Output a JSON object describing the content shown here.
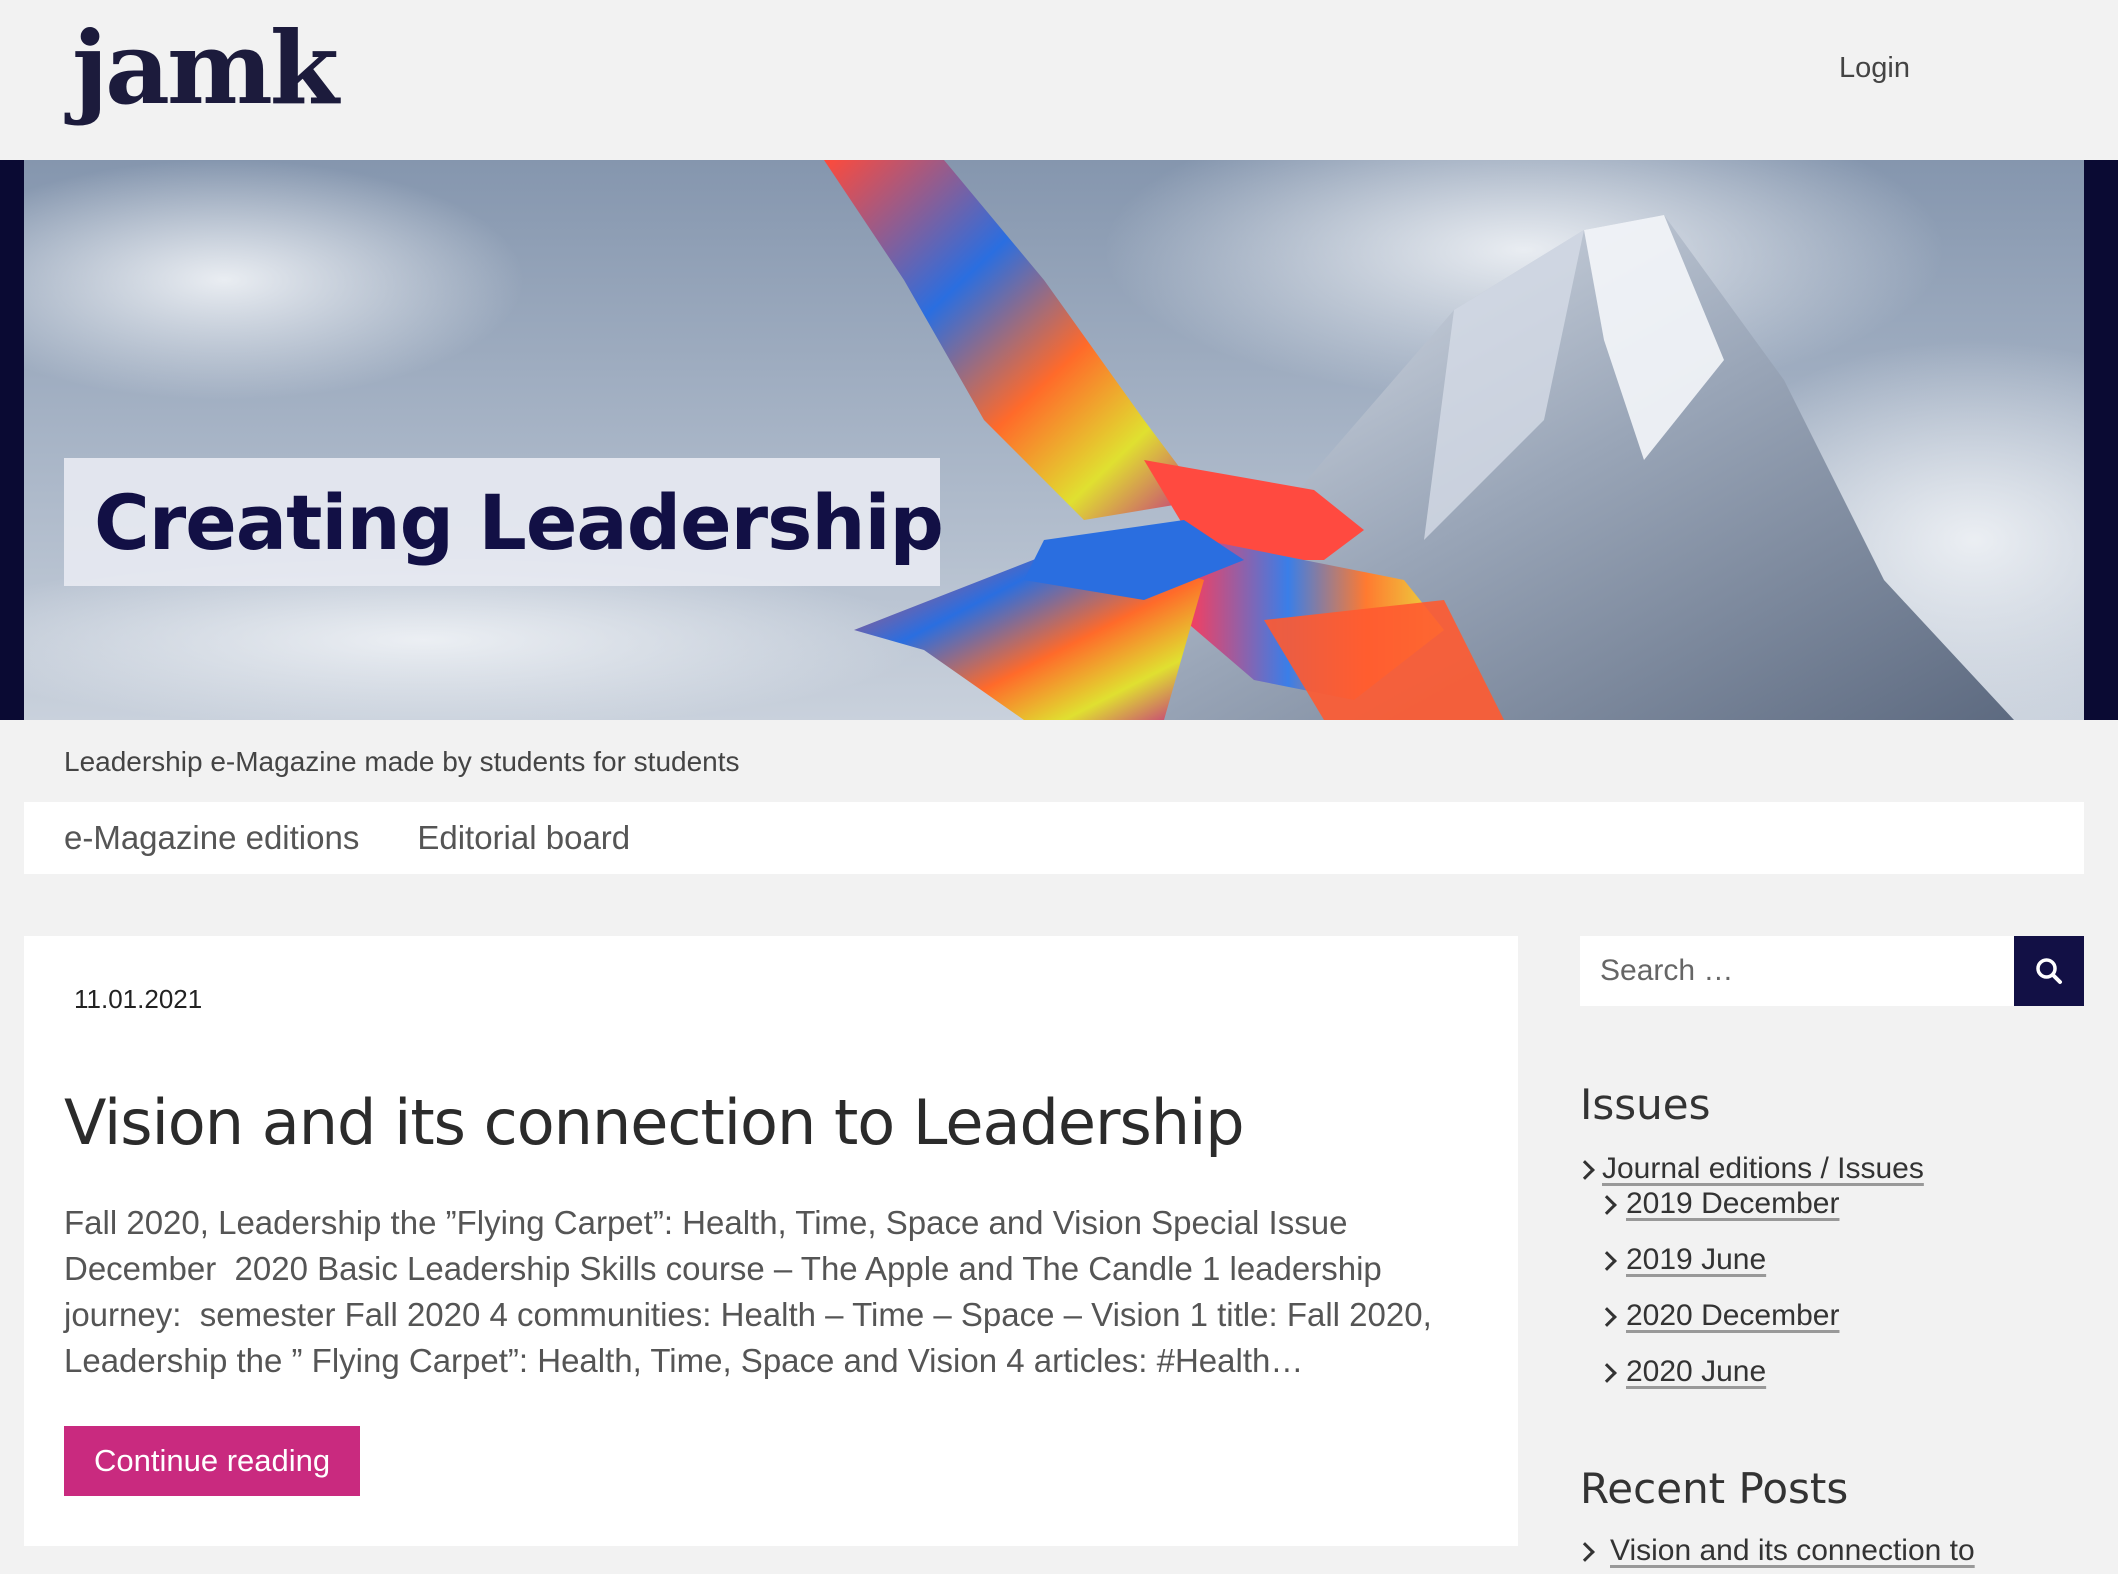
{
  "header": {
    "logo_text": "jamk",
    "login_label": "Login"
  },
  "hero": {
    "title": "Creating Leadership"
  },
  "tagline": "Leadership e-Magazine made by students for students",
  "nav": {
    "items": [
      {
        "label": "e-Magazine editions"
      },
      {
        "label": "Editorial board"
      }
    ]
  },
  "post": {
    "date": "11.01.2021",
    "title": "Vision and its connection to Leadership",
    "excerpt": "Fall 2020, Leadership the ”Flying Carpet”: Health, Time, Space and Vision Special Issue December  2020 Basic Leadership Skills course – The Apple and The Candle 1 leadership journey:  semester Fall 2020 4 communities: Health – Time – Space – Vision 1 title: Fall 2020, Leadership the ” Flying Carpet”: Health, Time, Space and Vision 4 articles: #Health…",
    "continue_label": "Continue reading"
  },
  "sidebar": {
    "search": {
      "placeholder": "Search …",
      "icon": "search-icon"
    },
    "issues": {
      "title": "Issues",
      "parent": "Journal editions / Issues",
      "children": [
        "2019 December",
        "2019 June",
        "2020 December",
        "2020 June"
      ]
    },
    "recent_posts": {
      "title": "Recent Posts",
      "items": [
        "Vision and its connection to"
      ]
    }
  },
  "colors": {
    "brand_navy": "#121045",
    "button_magenta": "#c92a7f",
    "page_background": "#f2f2f2"
  }
}
